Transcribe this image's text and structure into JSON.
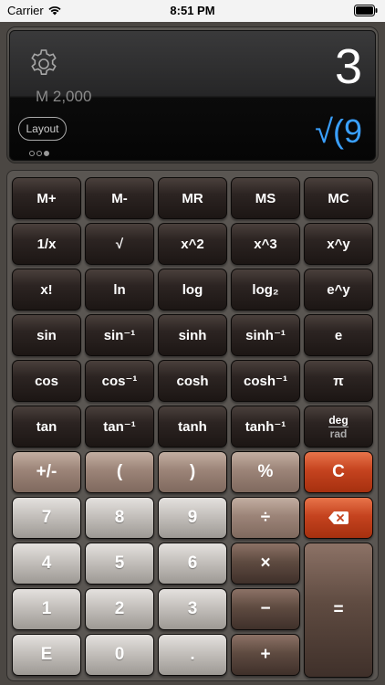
{
  "status": {
    "carrier": "Carrier",
    "time": "8:51 PM"
  },
  "display": {
    "value": "3",
    "memory": "M 2,000",
    "layout_label": "Layout",
    "expression": "√(9",
    "pages": 3,
    "active_page": 3
  },
  "keys": {
    "m_plus": "M+",
    "m_minus": "M-",
    "mr": "MR",
    "ms": "MS",
    "mc": "MC",
    "reciprocal": "1/x",
    "sqrt": "√",
    "square": "x^2",
    "cube": "x^3",
    "power": "x^y",
    "factorial": "x!",
    "ln": "ln",
    "log": "log",
    "log2": "log₂",
    "exp": "e^y",
    "sin": "sin",
    "asin": "sin⁻¹",
    "sinh": "sinh",
    "asinh": "sinh⁻¹",
    "e": "e",
    "cos": "cos",
    "acos": "cos⁻¹",
    "cosh": "cosh",
    "acosh": "cosh⁻¹",
    "pi": "π",
    "tan": "tan",
    "atan": "tan⁻¹",
    "tanh": "tanh",
    "atanh": "tanh⁻¹",
    "deg": "deg",
    "rad": "rad",
    "sign": "+/-",
    "lparen": "(",
    "rparen": ")",
    "percent": "%",
    "clear": "C",
    "seven": "7",
    "eight": "8",
    "nine": "9",
    "divide": "÷",
    "four": "4",
    "five": "5",
    "six": "6",
    "multiply": "×",
    "one": "1",
    "two": "2",
    "three": "3",
    "minus": "−",
    "e_key": "E",
    "zero": "0",
    "dot": ".",
    "plus": "+",
    "equals": "="
  },
  "colors": {
    "accent_blue": "#3aa0ff",
    "clear_red": "#c5431f"
  }
}
